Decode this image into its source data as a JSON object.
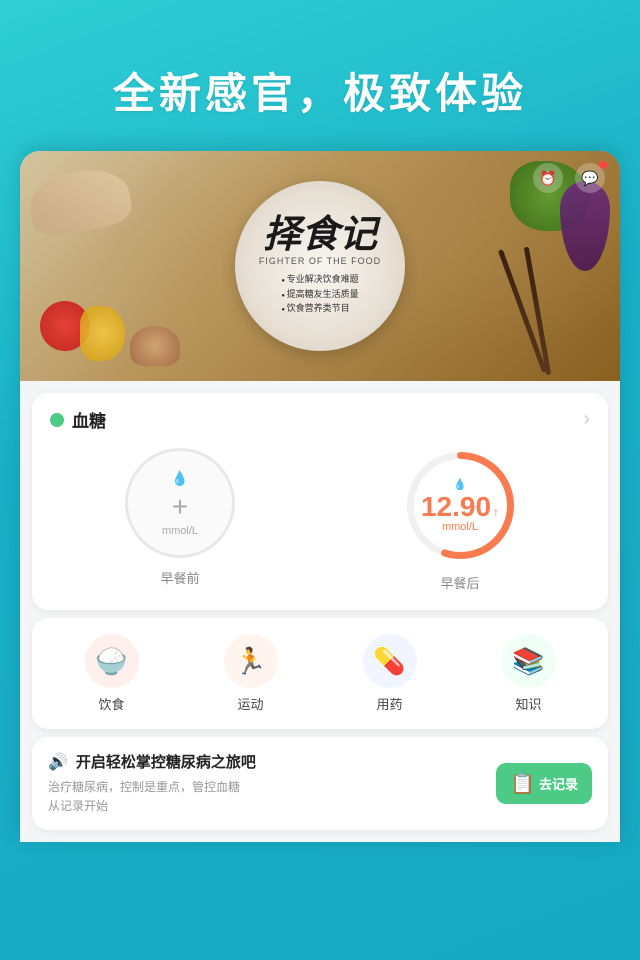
{
  "header": {
    "tagline": "全新感官，极致体验"
  },
  "banner": {
    "app_title": "择食记",
    "app_subtitle": "FIGHTER OF THE FOOD",
    "bullets": [
      "专业解决饮食难题",
      "提高糖友生活质量",
      "饮食营养类节目"
    ]
  },
  "blood_sugar_card": {
    "title": "血糖",
    "before_meal_label": "早餐前",
    "after_meal_label": "早餐后",
    "before_value": null,
    "after_value": "12.90",
    "after_arrow": "↑",
    "unit": "mmol/L"
  },
  "nav": {
    "items": [
      {
        "id": "diet",
        "label": "饮食",
        "icon": "🍚",
        "bg_color": "#fff0ee"
      },
      {
        "id": "exercise",
        "label": "运动",
        "icon": "🏃",
        "bg_color": "#fff5ee"
      },
      {
        "id": "medication",
        "label": "用药",
        "icon": "💊",
        "bg_color": "#f0f5ff"
      },
      {
        "id": "knowledge",
        "label": "知识",
        "icon": "📚",
        "bg_color": "#f0fff5"
      }
    ]
  },
  "info_card": {
    "icon": "🔊",
    "title": "开启轻松掌控糖尿病之旅吧",
    "body": "治疗糖尿病，控制是重点，管控血糖\n从记录开始",
    "button_label": "去记录"
  },
  "colors": {
    "primary_teal": "#1ec8d0",
    "green": "#4dca85",
    "orange": "#f87c4f",
    "ring_orange": "#f87c4f"
  }
}
